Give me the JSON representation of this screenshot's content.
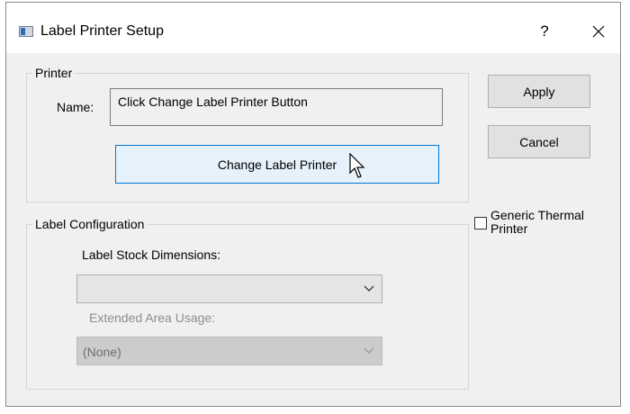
{
  "window": {
    "title": "Label Printer Setup",
    "help_label": "?",
    "icons": {
      "app": "app-window-icon",
      "close": "close-icon"
    }
  },
  "printer_group": {
    "legend": "Printer",
    "name_label": "Name:",
    "name_value": "Click Change Label Printer Button",
    "change_button": "Change Label Printer"
  },
  "buttons": {
    "apply": "Apply",
    "cancel": "Cancel"
  },
  "generic_thermal": {
    "label": "Generic Thermal Printer",
    "checked": false
  },
  "label_config": {
    "legend": "Label Configuration",
    "stock_dimensions_label": "Label Stock Dimensions:",
    "stock_dimensions_value": "",
    "extended_area_label": "Extended Area Usage:",
    "extended_area_value": "(None)"
  },
  "colors": {
    "accent": "#0078d7",
    "dialog_bg": "#f0f0f0"
  }
}
